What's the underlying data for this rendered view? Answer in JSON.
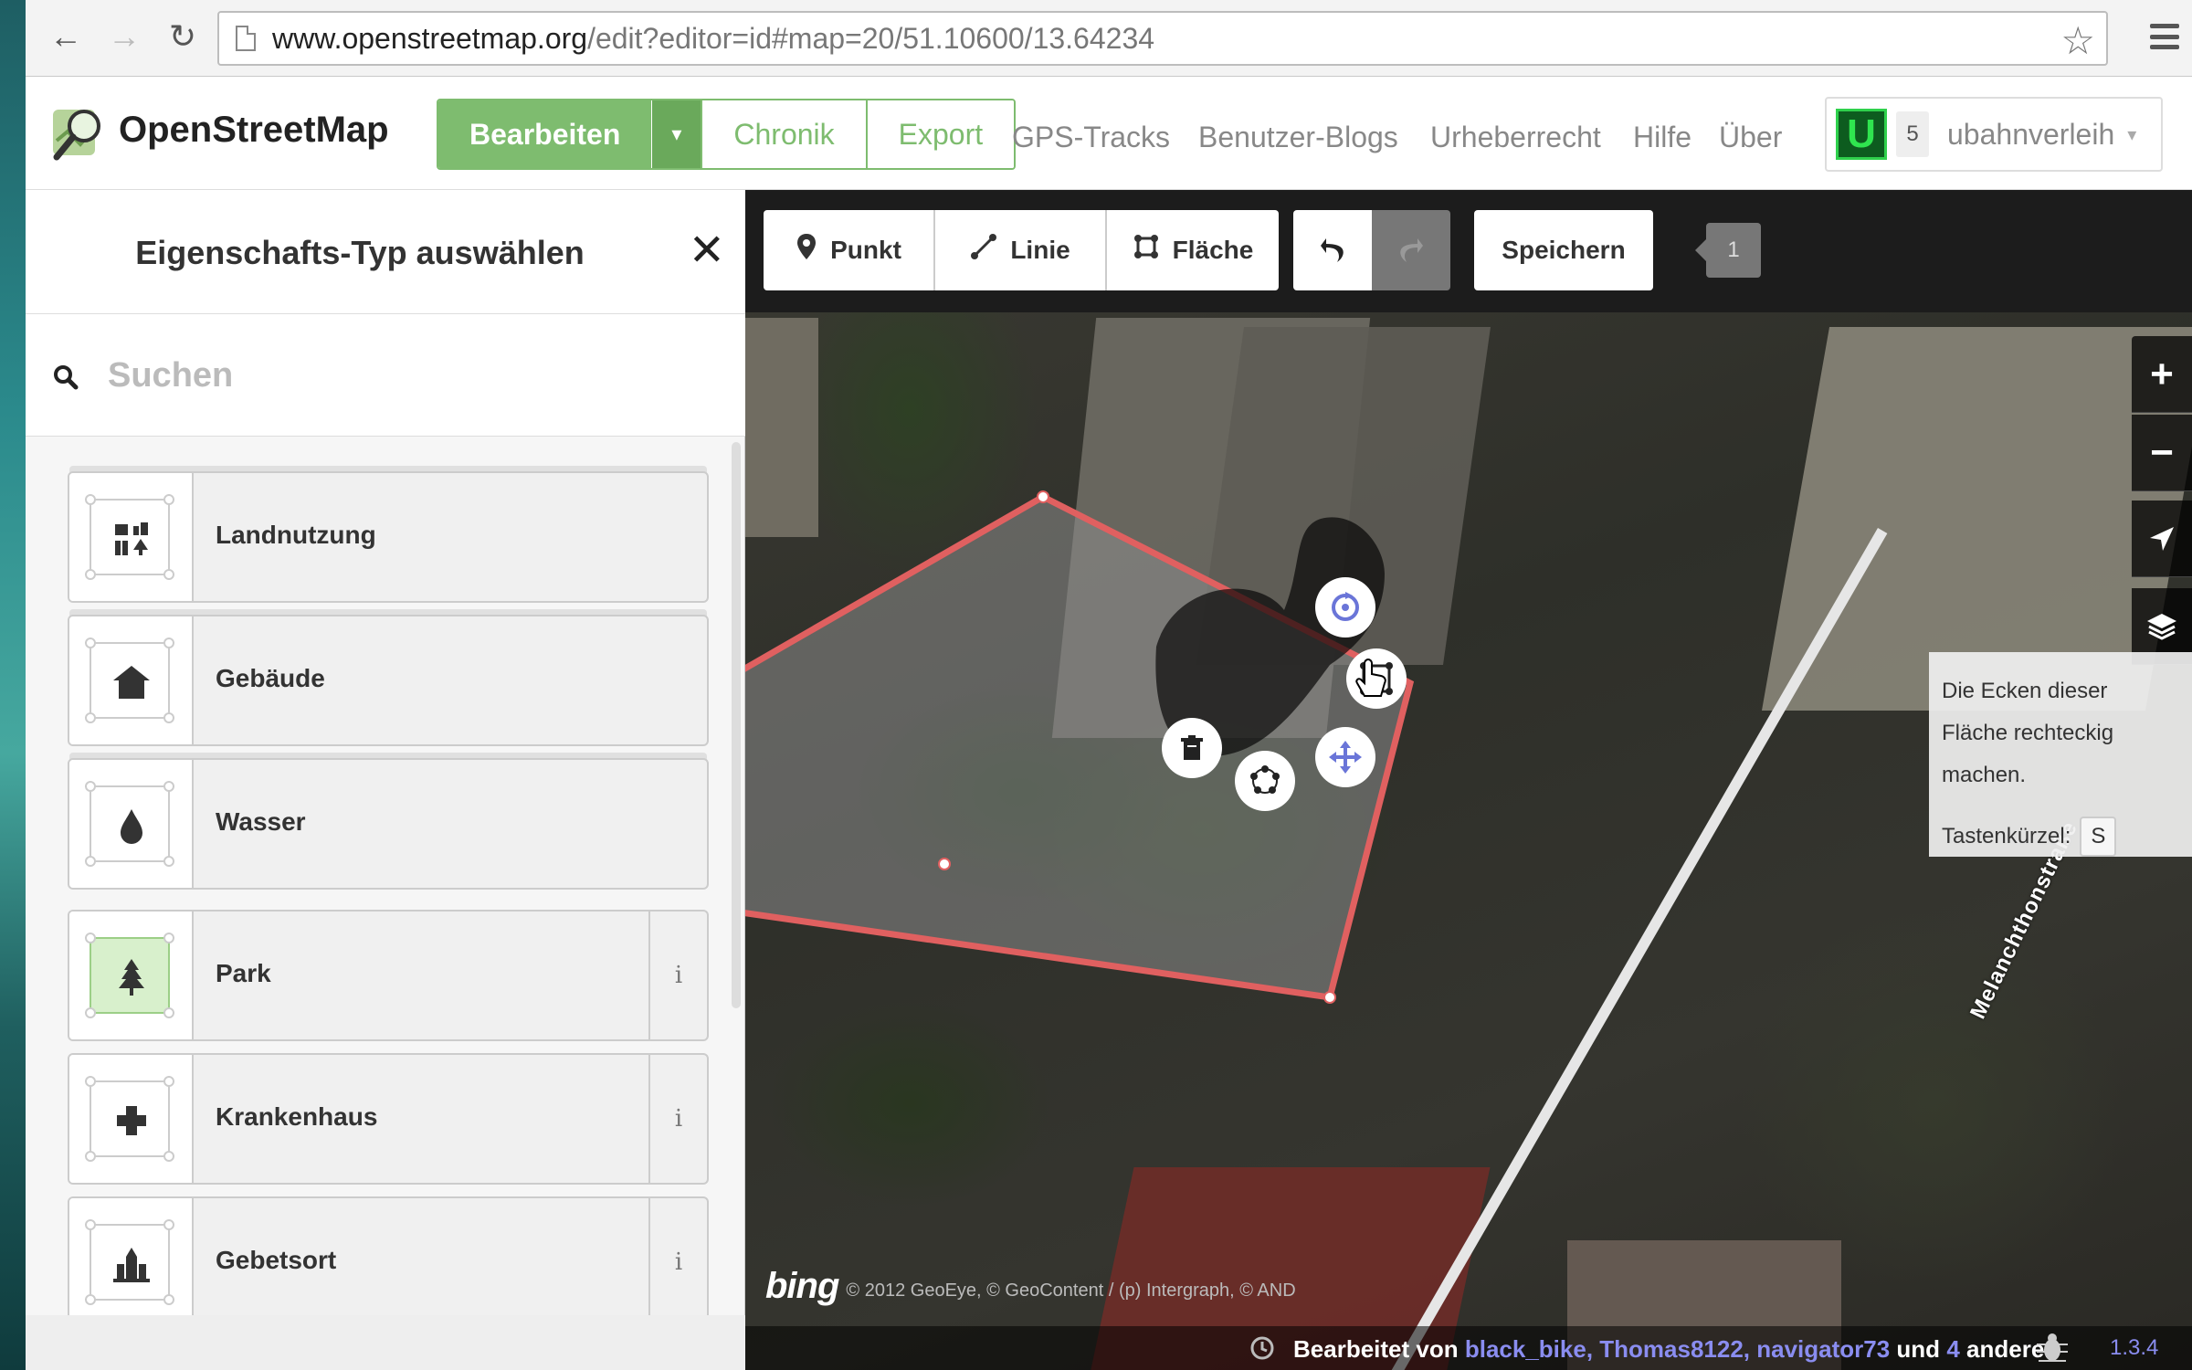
{
  "browser": {
    "url_host": "www.openstreetmap.org",
    "url_path": "/edit?editor=id#map=20/51.10600/13.64234"
  },
  "header": {
    "brand": "OpenStreetMap",
    "edit_label": "Bearbeiten",
    "history_label": "Chronik",
    "export_label": "Export",
    "nav_links": [
      "GPS-Tracks",
      "Benutzer-Blogs",
      "Urheberrecht",
      "Hilfe",
      "Über"
    ],
    "user": {
      "avatar_letter": "U",
      "count": "5",
      "name": "ubahnverleih"
    }
  },
  "sidebar": {
    "title": "Eigenschafts-Typ auswählen",
    "close_glyph": "✕",
    "search_placeholder": "Suchen",
    "presets": [
      {
        "label": "Landnutzung",
        "icon": "landuse-icon",
        "type": "category"
      },
      {
        "label": "Gebäude",
        "icon": "building-icon",
        "type": "category"
      },
      {
        "label": "Wasser",
        "icon": "water-icon",
        "type": "category"
      },
      {
        "label": "Park",
        "icon": "tree-icon",
        "type": "preset",
        "info": "i"
      },
      {
        "label": "Krankenhaus",
        "icon": "hospital-cross-icon",
        "type": "preset",
        "info": "i"
      },
      {
        "label": "Gebetsort",
        "icon": "place-of-worship-icon",
        "type": "preset",
        "info": "i"
      }
    ]
  },
  "toolbar": {
    "point_label": "Punkt",
    "line_label": "Linie",
    "area_label": "Fläche",
    "save_label": "Speichern",
    "edit_count": "1"
  },
  "map": {
    "street_label": "Melanchthonstraße",
    "tooltip": {
      "text": "Die Ecken dieser Fläche rechteckig machen.",
      "shortcut_label": "Tastenkürzel:",
      "shortcut_key": "S"
    },
    "attribution_logo": "bing",
    "attribution": "© 2012 GeoEye, © GeoContent / (p) Intergraph, © AND",
    "footer": {
      "prefix": "Bearbeitet von",
      "users": "black_bike, Thomas8122, navigator73",
      "und": "und",
      "others_count": "4",
      "others_label": "anderen",
      "version": "1.3.4"
    }
  },
  "colors": {
    "osm_green": "#7ebc6f",
    "selection_red": "#e06060",
    "link_blue": "#8a8df0"
  }
}
